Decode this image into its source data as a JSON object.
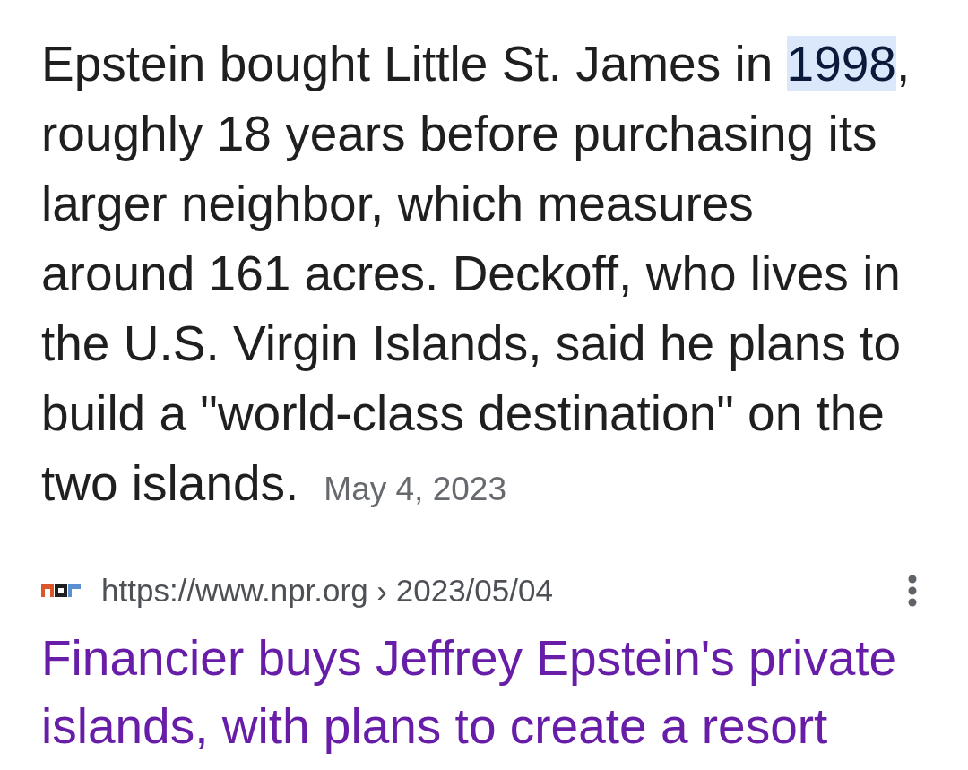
{
  "snippet": {
    "parts": [
      {
        "text": "Epstein bought Little St. James in ",
        "highlighted": false
      },
      {
        "text": "1998",
        "highlighted": true
      },
      {
        "text": ", roughly 18 years before purchasing its larger neighbor, which measures around 161 acres. Deckoff, who lives in the U.S. Virgin Islands, said he plans to build a \"world-class destination\" on the two islands.",
        "highlighted": false
      }
    ],
    "date": "May 4, 2023"
  },
  "result": {
    "url": "https://www.npr.org › 2023/05/04",
    "title": "Financier buys Jeffrey Epstein's private islands, with plans to create a resort"
  }
}
